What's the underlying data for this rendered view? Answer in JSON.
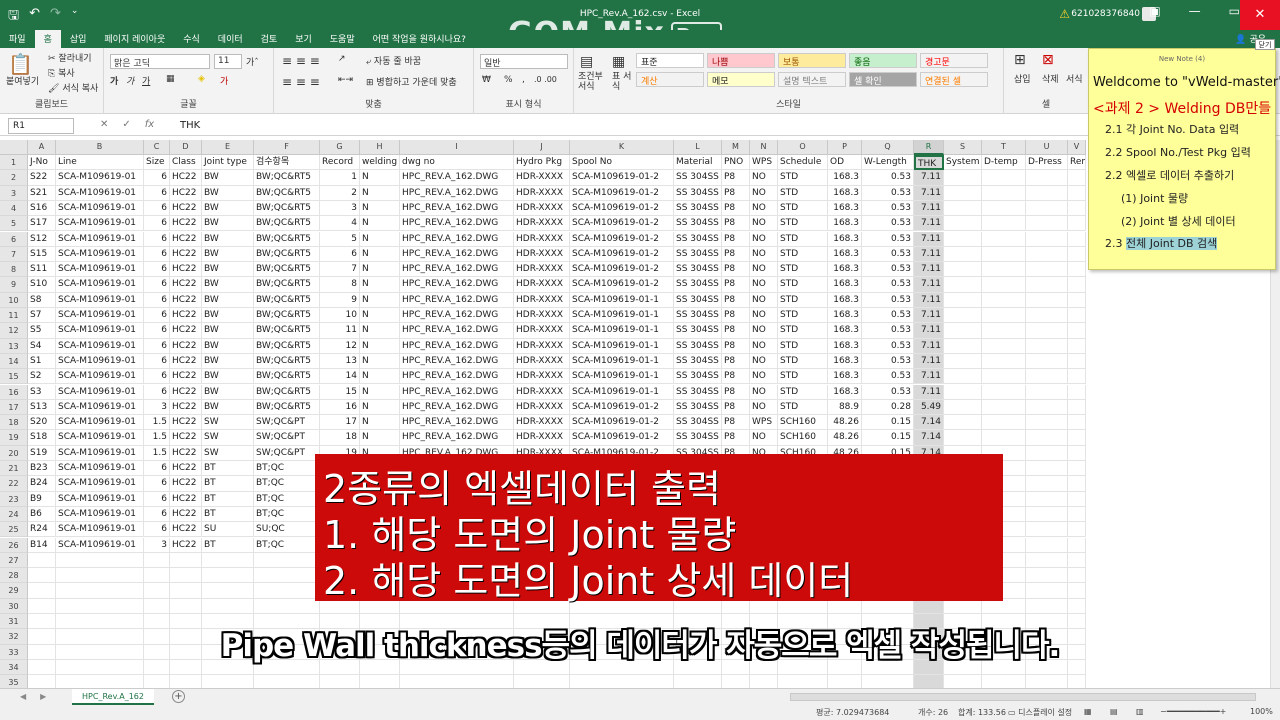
{
  "window": {
    "title": "HPC_Rev.A_162.csv  -  Excel",
    "user_id": "621028376840",
    "close_label": "✕",
    "minimize_label": "—",
    "restore_label": "▭",
    "warning_icon": "warning-icon"
  },
  "watermark": {
    "text": "GOM Mix",
    "pro": "Pro"
  },
  "tabs": [
    "파일",
    "홈",
    "삽입",
    "페이지 레이아웃",
    "수식",
    "데이터",
    "검토",
    "보기",
    "도움말",
    "어떤 작업을 원하시나요?"
  ],
  "share_label": "공유",
  "ribbon": {
    "clipboard": {
      "paste": "붙여넣기",
      "cut": "잘라내기",
      "copy": "복사",
      "format_painter": "서식 복사",
      "label": "클립보드"
    },
    "font": {
      "name": "맑은 고딕",
      "size": "11",
      "bold": "가",
      "italic": "가",
      "label": "글꼴"
    },
    "align": {
      "wrap": "자동 줄 바꿈",
      "merge": "병합하고 가운데 맞춤",
      "label": "맞춤"
    },
    "number": {
      "format": "일반",
      "percent": "%",
      "comma": ",",
      "label": "표시 형식"
    },
    "styles": {
      "conditional": "조건부 서식",
      "table": "표 서식",
      "label": "스타일",
      "boxes": [
        {
          "text": "표준",
          "bg": "#ffffff",
          "color": "#222222"
        },
        {
          "text": "나쁨",
          "bg": "#ffc7ce",
          "color": "#9c0006"
        },
        {
          "text": "보통",
          "bg": "#ffeb9c",
          "color": "#9c5700"
        },
        {
          "text": "좋음",
          "bg": "#c6efce",
          "color": "#006100"
        },
        {
          "text": "경고문",
          "bg": "#f3f3f3",
          "color": "#ff0000"
        },
        {
          "text": "계산",
          "bg": "#f2f2f2",
          "color": "#fa7d00"
        },
        {
          "text": "메모",
          "bg": "#ffffcc",
          "color": "#222222"
        },
        {
          "text": "설명 텍스트",
          "bg": "#f3f3f3",
          "color": "#7f7f7f"
        },
        {
          "text": "셀 확인",
          "bg": "#a5a5a5",
          "color": "#ffffff"
        },
        {
          "text": "연결된 셀",
          "bg": "#f3f3f3",
          "color": "#fa7d00"
        }
      ]
    },
    "cells": {
      "insert": "삽입",
      "delete": "삭제",
      "format": "서식",
      "label": "셀"
    }
  },
  "formula_bar": {
    "name_box": "R1",
    "cancel": "✕",
    "enter": "✓",
    "fx": "fx",
    "value": "THK"
  },
  "columns": [
    {
      "letter": "A",
      "w": 28
    },
    {
      "letter": "B",
      "w": 88
    },
    {
      "letter": "C",
      "w": 26
    },
    {
      "letter": "D",
      "w": 32
    },
    {
      "letter": "E",
      "w": 52
    },
    {
      "letter": "F",
      "w": 66
    },
    {
      "letter": "G",
      "w": 40
    },
    {
      "letter": "H",
      "w": 40
    },
    {
      "letter": "I",
      "w": 114
    },
    {
      "letter": "J",
      "w": 56
    },
    {
      "letter": "K",
      "w": 104
    },
    {
      "letter": "L",
      "w": 48
    },
    {
      "letter": "M",
      "w": 28
    },
    {
      "letter": "N",
      "w": 28
    },
    {
      "letter": "O",
      "w": 50
    },
    {
      "letter": "P",
      "w": 34
    },
    {
      "letter": "Q",
      "w": 52
    },
    {
      "letter": "R",
      "w": 30
    },
    {
      "letter": "S",
      "w": 38
    },
    {
      "letter": "T",
      "w": 44
    },
    {
      "letter": "U",
      "w": 42
    },
    {
      "letter": "V",
      "w": 18
    }
  ],
  "num_columns": [
    2,
    6,
    15,
    16,
    17
  ],
  "selected_column": 17,
  "headers": [
    "J-No",
    "Line",
    "Size",
    "Class",
    "Joint type",
    "검수항목",
    "Record",
    "welding",
    "dwg no",
    "Hydro Pkg",
    "Spool No",
    "Material",
    "PNO",
    "WPS",
    "Schedule",
    "OD",
    "W-Length",
    "THK",
    "System",
    "D-temp",
    "D-Press",
    "Rem"
  ],
  "rows": [
    [
      "S22",
      "SCA-M109619-01",
      "6",
      "HC22",
      "BW",
      "BW;QC&RT5",
      "1",
      "N",
      "HPC_REV.A_162.DWG",
      "HDR-XXXX",
      "SCA-M109619-01-2",
      "SS 304SS",
      "P8",
      "NO",
      "STD",
      "168.3",
      "0.53",
      "7.11"
    ],
    [
      "S21",
      "SCA-M109619-01",
      "6",
      "HC22",
      "BW",
      "BW;QC&RT5",
      "2",
      "N",
      "HPC_REV.A_162.DWG",
      "HDR-XXXX",
      "SCA-M109619-01-2",
      "SS 304SS",
      "P8",
      "NO",
      "STD",
      "168.3",
      "0.53",
      "7.11"
    ],
    [
      "S16",
      "SCA-M109619-01",
      "6",
      "HC22",
      "BW",
      "BW;QC&RT5",
      "3",
      "N",
      "HPC_REV.A_162.DWG",
      "HDR-XXXX",
      "SCA-M109619-01-2",
      "SS 304SS",
      "P8",
      "NO",
      "STD",
      "168.3",
      "0.53",
      "7.11"
    ],
    [
      "S17",
      "SCA-M109619-01",
      "6",
      "HC22",
      "BW",
      "BW;QC&RT5",
      "4",
      "N",
      "HPC_REV.A_162.DWG",
      "HDR-XXXX",
      "SCA-M109619-01-2",
      "SS 304SS",
      "P8",
      "NO",
      "STD",
      "168.3",
      "0.53",
      "7.11"
    ],
    [
      "S12",
      "SCA-M109619-01",
      "6",
      "HC22",
      "BW",
      "BW;QC&RT5",
      "5",
      "N",
      "HPC_REV.A_162.DWG",
      "HDR-XXXX",
      "SCA-M109619-01-2",
      "SS 304SS",
      "P8",
      "NO",
      "STD",
      "168.3",
      "0.53",
      "7.11"
    ],
    [
      "S15",
      "SCA-M109619-01",
      "6",
      "HC22",
      "BW",
      "BW;QC&RT5",
      "6",
      "N",
      "HPC_REV.A_162.DWG",
      "HDR-XXXX",
      "SCA-M109619-01-2",
      "SS 304SS",
      "P8",
      "NO",
      "STD",
      "168.3",
      "0.53",
      "7.11"
    ],
    [
      "S11",
      "SCA-M109619-01",
      "6",
      "HC22",
      "BW",
      "BW;QC&RT5",
      "7",
      "N",
      "HPC_REV.A_162.DWG",
      "HDR-XXXX",
      "SCA-M109619-01-2",
      "SS 304SS",
      "P8",
      "NO",
      "STD",
      "168.3",
      "0.53",
      "7.11"
    ],
    [
      "S10",
      "SCA-M109619-01",
      "6",
      "HC22",
      "BW",
      "BW;QC&RT5",
      "8",
      "N",
      "HPC_REV.A_162.DWG",
      "HDR-XXXX",
      "SCA-M109619-01-2",
      "SS 304SS",
      "P8",
      "NO",
      "STD",
      "168.3",
      "0.53",
      "7.11"
    ],
    [
      "S8",
      "SCA-M109619-01",
      "6",
      "HC22",
      "BW",
      "BW;QC&RT5",
      "9",
      "N",
      "HPC_REV.A_162.DWG",
      "HDR-XXXX",
      "SCA-M109619-01-1",
      "SS 304SS",
      "P8",
      "NO",
      "STD",
      "168.3",
      "0.53",
      "7.11"
    ],
    [
      "S7",
      "SCA-M109619-01",
      "6",
      "HC22",
      "BW",
      "BW;QC&RT5",
      "10",
      "N",
      "HPC_REV.A_162.DWG",
      "HDR-XXXX",
      "SCA-M109619-01-1",
      "SS 304SS",
      "P8",
      "NO",
      "STD",
      "168.3",
      "0.53",
      "7.11"
    ],
    [
      "S5",
      "SCA-M109619-01",
      "6",
      "HC22",
      "BW",
      "BW;QC&RT5",
      "11",
      "N",
      "HPC_REV.A_162.DWG",
      "HDR-XXXX",
      "SCA-M109619-01-1",
      "SS 304SS",
      "P8",
      "NO",
      "STD",
      "168.3",
      "0.53",
      "7.11"
    ],
    [
      "S4",
      "SCA-M109619-01",
      "6",
      "HC22",
      "BW",
      "BW;QC&RT5",
      "12",
      "N",
      "HPC_REV.A_162.DWG",
      "HDR-XXXX",
      "SCA-M109619-01-1",
      "SS 304SS",
      "P8",
      "NO",
      "STD",
      "168.3",
      "0.53",
      "7.11"
    ],
    [
      "S1",
      "SCA-M109619-01",
      "6",
      "HC22",
      "BW",
      "BW;QC&RT5",
      "13",
      "N",
      "HPC_REV.A_162.DWG",
      "HDR-XXXX",
      "SCA-M109619-01-1",
      "SS 304SS",
      "P8",
      "NO",
      "STD",
      "168.3",
      "0.53",
      "7.11"
    ],
    [
      "S2",
      "SCA-M109619-01",
      "6",
      "HC22",
      "BW",
      "BW;QC&RT5",
      "14",
      "N",
      "HPC_REV.A_162.DWG",
      "HDR-XXXX",
      "SCA-M109619-01-1",
      "SS 304SS",
      "P8",
      "NO",
      "STD",
      "168.3",
      "0.53",
      "7.11"
    ],
    [
      "S3",
      "SCA-M109619-01",
      "6",
      "HC22",
      "BW",
      "BW;QC&RT5",
      "15",
      "N",
      "HPC_REV.A_162.DWG",
      "HDR-XXXX",
      "SCA-M109619-01-1",
      "SS 304SS",
      "P8",
      "NO",
      "STD",
      "168.3",
      "0.53",
      "7.11"
    ],
    [
      "S13",
      "SCA-M109619-01",
      "3",
      "HC22",
      "BW",
      "BW;QC&RT5",
      "16",
      "N",
      "HPC_REV.A_162.DWG",
      "HDR-XXXX",
      "SCA-M109619-01-2",
      "SS 304SS",
      "P8",
      "NO",
      "STD",
      "88.9",
      "0.28",
      "5.49"
    ],
    [
      "S20",
      "SCA-M109619-01",
      "1.5",
      "HC22",
      "SW",
      "SW;QC&PT",
      "17",
      "N",
      "HPC_REV.A_162.DWG",
      "HDR-XXXX",
      "SCA-M109619-01-2",
      "SS 304SS",
      "P8",
      "WPS",
      "SCH160",
      "48.26",
      "0.15",
      "7.14"
    ],
    [
      "S18",
      "SCA-M109619-01",
      "1.5",
      "HC22",
      "SW",
      "SW;QC&PT",
      "18",
      "N",
      "HPC_REV.A_162.DWG",
      "HDR-XXXX",
      "SCA-M109619-01-2",
      "SS 304SS",
      "P8",
      "NO",
      "SCH160",
      "48.26",
      "0.15",
      "7.14"
    ],
    [
      "S19",
      "SCA-M109619-01",
      "1.5",
      "HC22",
      "SW",
      "SW;QC&PT",
      "19",
      "N",
      "HPC_REV.A_162.DWG",
      "HDR-XXXX",
      "SCA-M109619-01-2",
      "SS 304SS",
      "P8",
      "NO",
      "SCH160",
      "48.26",
      "0.15",
      "7.14"
    ],
    [
      "B23",
      "SCA-M109619-01",
      "6",
      "HC22",
      "BT",
      "BT;QC"
    ],
    [
      "B24",
      "SCA-M109619-01",
      "6",
      "HC22",
      "BT",
      "BT;QC"
    ],
    [
      "B9",
      "SCA-M109619-01",
      "6",
      "HC22",
      "BT",
      "BT;QC"
    ],
    [
      "B6",
      "SCA-M109619-01",
      "6",
      "HC22",
      "BT",
      "BT;QC"
    ],
    [
      "R24",
      "SCA-M109619-01",
      "6",
      "HC22",
      "SU",
      "SU;QC"
    ],
    [
      "B14",
      "SCA-M109619-01",
      "3",
      "HC22",
      "BT",
      "BT;QC"
    ]
  ],
  "total_rows": 35,
  "note": {
    "title": "New Note (4)",
    "close": "닫기",
    "lines": [
      {
        "text": "Weldcome to \"vWeld-master\"",
        "color": "#111111",
        "size": 13,
        "indent": 4
      },
      {
        "text": "<과제 2 > Welding DB만들",
        "color": "#d40000",
        "size": 14,
        "indent": 4
      },
      {
        "text": "2.1 각 Joint No. Data 입력",
        "color": "#222222",
        "size": 11,
        "indent": 16
      },
      {
        "text": "2.2  Spool No./Test Pkg 입력",
        "color": "#222222",
        "size": 11,
        "indent": 16
      },
      {
        "text": "2.2 엑셀로 데이터 추출하기",
        "color": "#222222",
        "size": 11,
        "indent": 16
      },
      {
        "text": "(1) Joint 물량",
        "color": "#222222",
        "size": 11,
        "indent": 32
      },
      {
        "text": "(2) Joint 별 상세 데이터",
        "color": "#222222",
        "size": 11,
        "indent": 32
      }
    ],
    "last_prefix": "2.3 ",
    "last_highlight": "전체 Joint DB 검색"
  },
  "overlay": {
    "lines": [
      "2종류의 엑셀데이터 출력",
      "1. 해당 도면의 Joint 물량",
      "2. 해당 도면의 Joint 상세 데이터"
    ],
    "subtitle": "Pipe Wall thickness등의 데이터가 자동으로 엑셀 작성됩니다."
  },
  "sheet": {
    "tab": "HPC_Rev.A_162",
    "add": "+"
  },
  "status": {
    "average": "평균: 7.029473684",
    "count": "개수: 26",
    "sum": "합계: 133.56",
    "display": "디스플레이 설정",
    "zoom": "100%"
  }
}
